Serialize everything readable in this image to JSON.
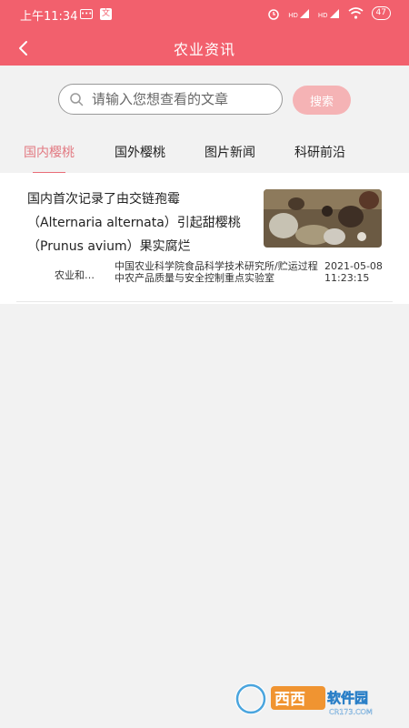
{
  "status_bar": {
    "time": "上午11:34",
    "app_badge": "文",
    "signal_a": "HD",
    "signal_b": "HD",
    "battery": "47"
  },
  "header": {
    "title": "农业资讯"
  },
  "search": {
    "placeholder": "请输入您想查看的文章",
    "button_label": "搜索"
  },
  "tabs": [
    {
      "label": "国内樱桃",
      "active": true
    },
    {
      "label": "国外樱桃",
      "active": false
    },
    {
      "label": "图片新闻",
      "active": false
    },
    {
      "label": "科研前沿",
      "active": false
    }
  ],
  "articles": [
    {
      "title": "国内首次记录了由交链孢霉（Alternaria alternata）引起甜樱桃（Prunus avium）果实腐烂",
      "source": "农业和…",
      "organization": "中国农业科学院食品科学技术研究所/贮运过程中农产品质量与安全控制重点实验室",
      "time": "2021-05-08 11:23:15"
    }
  ],
  "watermark": {
    "text": "西西软件园",
    "sub": "CR173.COM"
  },
  "colors": {
    "brand": "#f2606d",
    "search_button": "#f5b3b5",
    "tab_active": "#e27a82"
  }
}
